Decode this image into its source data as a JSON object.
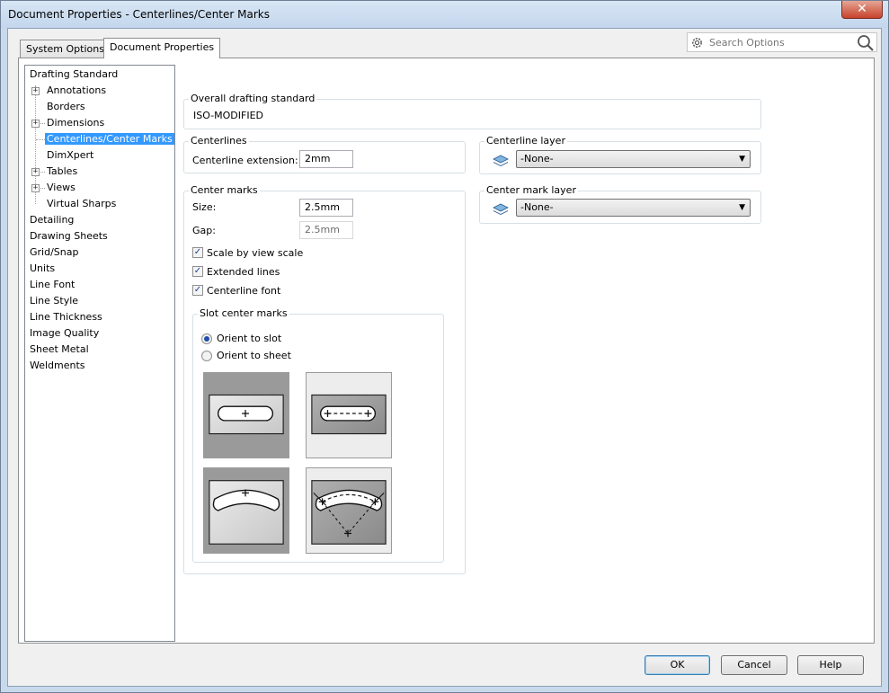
{
  "window": {
    "title": "Document Properties - Centerlines/Center Marks",
    "close_label": "✕"
  },
  "tabs": [
    {
      "label": "System Options",
      "active": false
    },
    {
      "label": "Document Properties",
      "active": true
    }
  ],
  "search": {
    "placeholder": "Search Options"
  },
  "tree": {
    "items": [
      {
        "label": "Drafting Standard"
      },
      {
        "label": "Annotations"
      },
      {
        "label": "Borders"
      },
      {
        "label": "Dimensions"
      },
      {
        "label": "Centerlines/Center Marks",
        "selected": true
      },
      {
        "label": "DimXpert"
      },
      {
        "label": "Tables"
      },
      {
        "label": "Views"
      },
      {
        "label": "Virtual Sharps"
      },
      {
        "label": "Detailing"
      },
      {
        "label": "Drawing Sheets"
      },
      {
        "label": "Grid/Snap"
      },
      {
        "label": "Units"
      },
      {
        "label": "Line Font"
      },
      {
        "label": "Line Style"
      },
      {
        "label": "Line Thickness"
      },
      {
        "label": "Image Quality"
      },
      {
        "label": "Sheet Metal"
      },
      {
        "label": "Weldments"
      }
    ],
    "expander_symbol": "+"
  },
  "overall": {
    "title": "Overall drafting standard",
    "value": "ISO-MODIFIED"
  },
  "centerlines": {
    "title": "Centerlines",
    "extension_label": "Centerline extension:",
    "extension_value": "2mm"
  },
  "center_marks": {
    "title": "Center marks",
    "size_label": "Size:",
    "size_value": "2.5mm",
    "gap_label": "Gap:",
    "gap_value": "2.5mm",
    "scale_by_view_label": "Scale by view scale",
    "scale_by_view_checked": true,
    "extended_lines_label": "Extended lines",
    "extended_lines_checked": true,
    "centerline_font_label": "Centerline font",
    "centerline_font_checked": true,
    "check_mark": "✓"
  },
  "slot": {
    "title": "Slot center marks",
    "orient_slot_label": "Orient to slot",
    "orient_sheet_label": "Orient to sheet",
    "selected": "orient_slot"
  },
  "centerline_layer": {
    "title": "Centerline layer",
    "value": "-None-",
    "arrow": "▼"
  },
  "centermark_layer": {
    "title": "Center mark layer",
    "value": "-None-",
    "arrow": "▼"
  },
  "buttons": {
    "ok": "OK",
    "cancel": "Cancel",
    "help": "Help"
  }
}
